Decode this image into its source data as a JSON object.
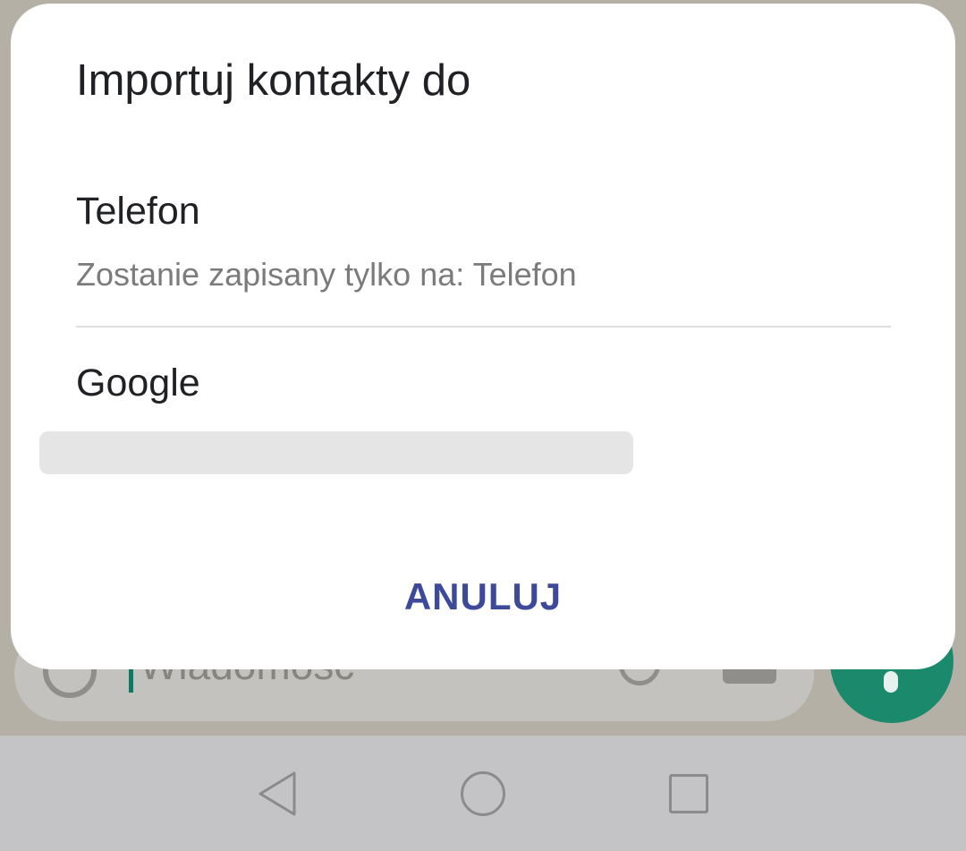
{
  "dialog": {
    "title": "Importuj kontakty do",
    "options": [
      {
        "title": "Telefon",
        "subtitle": "Zostanie zapisany tylko na: Telefon"
      },
      {
        "title": "Google"
      }
    ],
    "cancel_label": "ANULUJ"
  },
  "background": {
    "compose_placeholder": "Wiadomość"
  },
  "colors": {
    "accent_button": "#3d4a9a",
    "fab_green": "#1b8a6c"
  },
  "icons": {
    "compose_left": "emoji-icon",
    "compose_right": [
      "attach-icon",
      "camera-icon"
    ],
    "fab": "mic-icon",
    "nav": [
      "back-icon",
      "home-icon",
      "recent-apps-icon"
    ]
  }
}
